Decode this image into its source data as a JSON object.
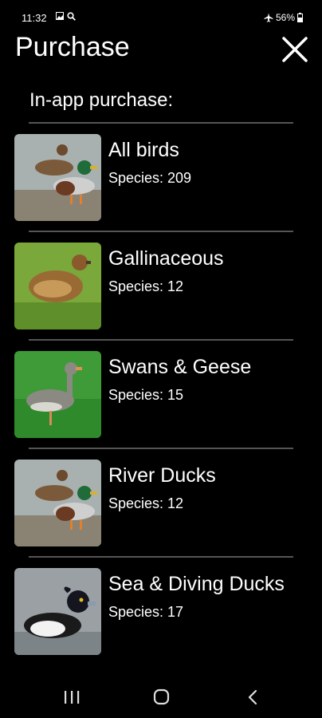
{
  "status_bar": {
    "time": "11:32",
    "battery": "56%"
  },
  "header": {
    "title": "Purchase"
  },
  "section": {
    "heading": "In-app purchase:"
  },
  "items": [
    {
      "title": "All birds",
      "species": "Species: 209",
      "image": "mallard-pair-photo"
    },
    {
      "title": "Gallinaceous",
      "species": "Species: 12",
      "image": "quail-photo"
    },
    {
      "title": "Swans & Geese",
      "species": "Species: 15",
      "image": "greylag-goose-photo"
    },
    {
      "title": "River Ducks",
      "species": "Species: 12",
      "image": "mallard-pair-photo"
    },
    {
      "title": "Sea & Diving Ducks",
      "species": "Species: 17",
      "image": "tufted-duck-photo"
    }
  ],
  "colors": {
    "background": "#000000",
    "text": "#ffffff",
    "divider": "#555555"
  }
}
